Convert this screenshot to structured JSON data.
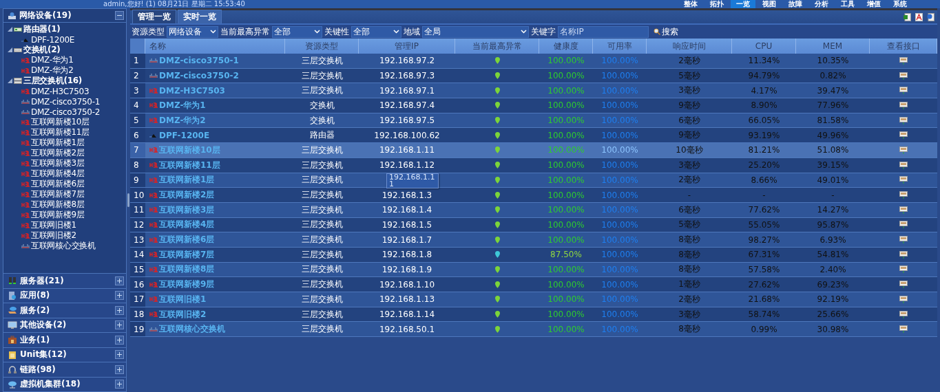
{
  "top_bar": {
    "greeting": "admin,您好! (1) 08月21日 星期二 15:53:40",
    "nav": [
      {
        "label": "整体",
        "selected": false
      },
      {
        "label": "拓扑",
        "selected": false
      },
      {
        "label": "一览",
        "selected": true
      },
      {
        "label": "视图",
        "selected": false
      },
      {
        "label": "故障",
        "selected": false
      },
      {
        "label": "分析",
        "selected": false
      },
      {
        "label": "工具",
        "selected": false
      },
      {
        "label": "增值",
        "selected": false
      },
      {
        "label": "系统",
        "selected": false
      }
    ]
  },
  "sidebar": {
    "title": "网络设备(19)",
    "expanded": true,
    "groups": [
      {
        "label": "路由器(1)",
        "kind": "router",
        "expanded": true,
        "children": [
          {
            "label": "DPF-1200E",
            "kind": "router"
          }
        ]
      },
      {
        "label": "交换机(2)",
        "kind": "switch",
        "expanded": true,
        "children": [
          {
            "label": "DMZ-华为1",
            "kind": "h3c"
          },
          {
            "label": "DMZ-华为2",
            "kind": "h3c"
          }
        ]
      },
      {
        "label": "三层交换机(16)",
        "kind": "stack",
        "expanded": true,
        "children": [
          {
            "label": "DMZ-H3C7503",
            "kind": "h3c"
          },
          {
            "label": "DMZ-cisco3750-1",
            "kind": "cisco"
          },
          {
            "label": "DMZ-cisco3750-2",
            "kind": "cisco"
          },
          {
            "label": "互联网新楼10层",
            "kind": "h3c"
          },
          {
            "label": "互联网新楼11层",
            "kind": "h3c"
          },
          {
            "label": "互联网新楼1层",
            "kind": "h3c"
          },
          {
            "label": "互联网新楼2层",
            "kind": "h3c"
          },
          {
            "label": "互联网新楼3层",
            "kind": "h3c"
          },
          {
            "label": "互联网新楼4层",
            "kind": "h3c"
          },
          {
            "label": "互联网新楼6层",
            "kind": "h3c"
          },
          {
            "label": "互联网新楼7层",
            "kind": "h3c"
          },
          {
            "label": "互联网新楼8层",
            "kind": "h3c"
          },
          {
            "label": "互联网新楼9层",
            "kind": "h3c"
          },
          {
            "label": "互联网旧楼1",
            "kind": "h3c"
          },
          {
            "label": "互联网旧楼2",
            "kind": "h3c"
          },
          {
            "label": "互联网核心交换机",
            "kind": "cisco"
          }
        ]
      }
    ],
    "sections": [
      {
        "label": "服务器(21)",
        "kind": "server"
      },
      {
        "label": "应用(8)",
        "kind": "app"
      },
      {
        "label": "服务(2)",
        "kind": "service"
      },
      {
        "label": "其他设备(2)",
        "kind": "monitor"
      },
      {
        "label": "业务(1)",
        "kind": "briefcase"
      },
      {
        "label": "Unit集(12)",
        "kind": "unit"
      },
      {
        "label": "链路(98)",
        "kind": "link"
      },
      {
        "label": "虚拟机集群(18)",
        "kind": "cloud"
      }
    ]
  },
  "tabs": [
    {
      "label": "管理一览",
      "selected": false
    },
    {
      "label": "实时一览",
      "selected": true
    }
  ],
  "filters": [
    {
      "label": "资源类型",
      "value": "网络设备",
      "kind": "select"
    },
    {
      "label": "当前最高异常",
      "value": "全部",
      "kind": "select"
    },
    {
      "label": "关键性",
      "value": "全部",
      "kind": "select"
    },
    {
      "label": "地域",
      "value": "全局",
      "kind": "select"
    },
    {
      "label": "关键字",
      "placeholder": "名称IP",
      "kind": "input"
    }
  ],
  "search_button": "搜索",
  "table": {
    "columns": [
      "名称",
      "资源类型",
      "管理IP",
      "当前最高异常",
      "健康度",
      "可用率",
      "响应时间",
      "CPU",
      "MEM",
      "查看接口"
    ],
    "rows": [
      {
        "no": "1",
        "kind": "cisco",
        "name": "DMZ-cisco3750-1",
        "type": "三层交换机",
        "ip": "192.168.97.2",
        "color": "#7cd43a",
        "health": "100.00%",
        "availability": "100.00%",
        "response": "2毫秒",
        "cpu": "11.34%",
        "mem": "10.35%",
        "hovered": false
      },
      {
        "no": "2",
        "kind": "cisco",
        "name": "DMZ-cisco3750-2",
        "type": "三层交换机",
        "ip": "192.168.97.3",
        "color": "#7cd43a",
        "health": "100.00%",
        "availability": "100.00%",
        "response": "5毫秒",
        "cpu": "94.79%",
        "mem": "0.82%",
        "hovered": false
      },
      {
        "no": "3",
        "kind": "h3c",
        "name": "DMZ-H3C7503",
        "type": "三层交换机",
        "ip": "192.168.97.1",
        "color": "#7cd43a",
        "health": "100.00%",
        "availability": "100.00%",
        "response": "3毫秒",
        "cpu": "4.17%",
        "mem": "39.47%",
        "hovered": false
      },
      {
        "no": "4",
        "kind": "h3c",
        "name": "DMZ-华为1",
        "type": "交换机",
        "ip": "192.168.97.4",
        "color": "#7cd43a",
        "health": "100.00%",
        "availability": "100.00%",
        "response": "9毫秒",
        "cpu": "8.90%",
        "mem": "77.96%",
        "hovered": false
      },
      {
        "no": "5",
        "kind": "h3c",
        "name": "DMZ-华为2",
        "type": "交换机",
        "ip": "192.168.97.5",
        "color": "#7cd43a",
        "health": "100.00%",
        "availability": "100.00%",
        "response": "6毫秒",
        "cpu": "66.05%",
        "mem": "81.58%",
        "hovered": false
      },
      {
        "no": "6",
        "kind": "router",
        "name": "DPF-1200E",
        "type": "路由器",
        "ip": "192.168.100.62",
        "color": "#7cd43a",
        "health": "100.00%",
        "availability": "100.00%",
        "response": "9毫秒",
        "cpu": "93.19%",
        "mem": "49.96%",
        "hovered": false
      },
      {
        "no": "7",
        "kind": "h3c",
        "name": "互联网新楼10层",
        "type": "三层交换机",
        "ip": "192.168.1.11",
        "color": "#7cd43a",
        "health": "100.00%",
        "availability": "100.00%",
        "response": "10毫秒",
        "cpu": "81.21%",
        "mem": "51.08%",
        "hovered": true
      },
      {
        "no": "8",
        "kind": "h3c",
        "name": "互联网新楼11层",
        "type": "三层交换机",
        "ip": "192.168.1.12",
        "color": "#7cd43a",
        "health": "100.00%",
        "availability": "100.00%",
        "response": "3毫秒",
        "cpu": "25.20%",
        "mem": "39.15%",
        "hovered": false
      },
      {
        "no": "9",
        "kind": "h3c",
        "name": "互联网新楼1层",
        "type": "三层交换机",
        "tooltip": [
          "192.168.1.1",
          "1"
        ],
        "color": "#7cd43a",
        "health": "100.00%",
        "availability": "100.00%",
        "response": "2毫秒",
        "cpu": "8.66%",
        "mem": "49.01%",
        "hovered": false
      },
      {
        "no": "10",
        "kind": "h3c",
        "name": "互联网新楼2层",
        "type": "三层交换机",
        "ip": "192.168.1.3",
        "color": "#7cd43a",
        "health": "100.00%",
        "availability": "100.00%",
        "response": "-",
        "cpu": "-",
        "mem": "-",
        "hovered": false
      },
      {
        "no": "11",
        "kind": "h3c",
        "name": "互联网新楼3层",
        "type": "三层交换机",
        "ip": "192.168.1.4",
        "color": "#7cd43a",
        "health": "100.00%",
        "availability": "100.00%",
        "response": "6毫秒",
        "cpu": "77.62%",
        "mem": "14.27%",
        "hovered": false
      },
      {
        "no": "12",
        "kind": "h3c",
        "name": "互联网新楼4层",
        "type": "三层交换机",
        "ip": "192.168.1.5",
        "color": "#7cd43a",
        "health": "100.00%",
        "availability": "100.00%",
        "response": "5毫秒",
        "cpu": "55.05%",
        "mem": "95.87%",
        "hovered": false
      },
      {
        "no": "13",
        "kind": "h3c",
        "name": "互联网新楼6层",
        "type": "三层交换机",
        "ip": "192.168.1.7",
        "color": "#7cd43a",
        "health": "100.00%",
        "availability": "100.00%",
        "response": "8毫秒",
        "cpu": "98.27%",
        "mem": "6.93%",
        "hovered": false
      },
      {
        "no": "14",
        "kind": "h3c",
        "name": "互联网新楼7层",
        "type": "三层交换机",
        "ip": "192.168.1.8",
        "color": "#3ec8d8",
        "health": "87.50%",
        "availability": "100.00%",
        "response": "8毫秒",
        "cpu": "67.31%",
        "mem": "54.81%",
        "hovered": false
      },
      {
        "no": "15",
        "kind": "h3c",
        "name": "互联网新楼8层",
        "type": "三层交换机",
        "ip": "192.168.1.9",
        "color": "#7cd43a",
        "health": "100.00%",
        "availability": "100.00%",
        "response": "8毫秒",
        "cpu": "57.58%",
        "mem": "2.40%",
        "hovered": false
      },
      {
        "no": "16",
        "kind": "h3c",
        "name": "互联网新楼9层",
        "type": "三层交换机",
        "ip": "192.168.1.10",
        "color": "#7cd43a",
        "health": "100.00%",
        "availability": "100.00%",
        "response": "1毫秒",
        "cpu": "27.62%",
        "mem": "69.23%",
        "hovered": false
      },
      {
        "no": "17",
        "kind": "h3c",
        "name": "互联网旧楼1",
        "type": "三层交换机",
        "ip": "192.168.1.13",
        "color": "#7cd43a",
        "health": "100.00%",
        "availability": "100.00%",
        "response": "2毫秒",
        "cpu": "21.68%",
        "mem": "92.19%",
        "hovered": false
      },
      {
        "no": "18",
        "kind": "h3c",
        "name": "互联网旧楼2",
        "type": "三层交换机",
        "ip": "192.168.1.14",
        "color": "#7cd43a",
        "health": "100.00%",
        "availability": "100.00%",
        "response": "3毫秒",
        "cpu": "58.74%",
        "mem": "25.66%",
        "hovered": false
      },
      {
        "no": "19",
        "kind": "cisco",
        "name": "互联网核心交换机",
        "type": "三层交换机",
        "ip": "192.168.50.1",
        "color": "#7cd43a",
        "health": "100.00%",
        "availability": "100.00%",
        "response": "8毫秒",
        "cpu": "0.99%",
        "mem": "30.98%",
        "hovered": false
      }
    ]
  }
}
